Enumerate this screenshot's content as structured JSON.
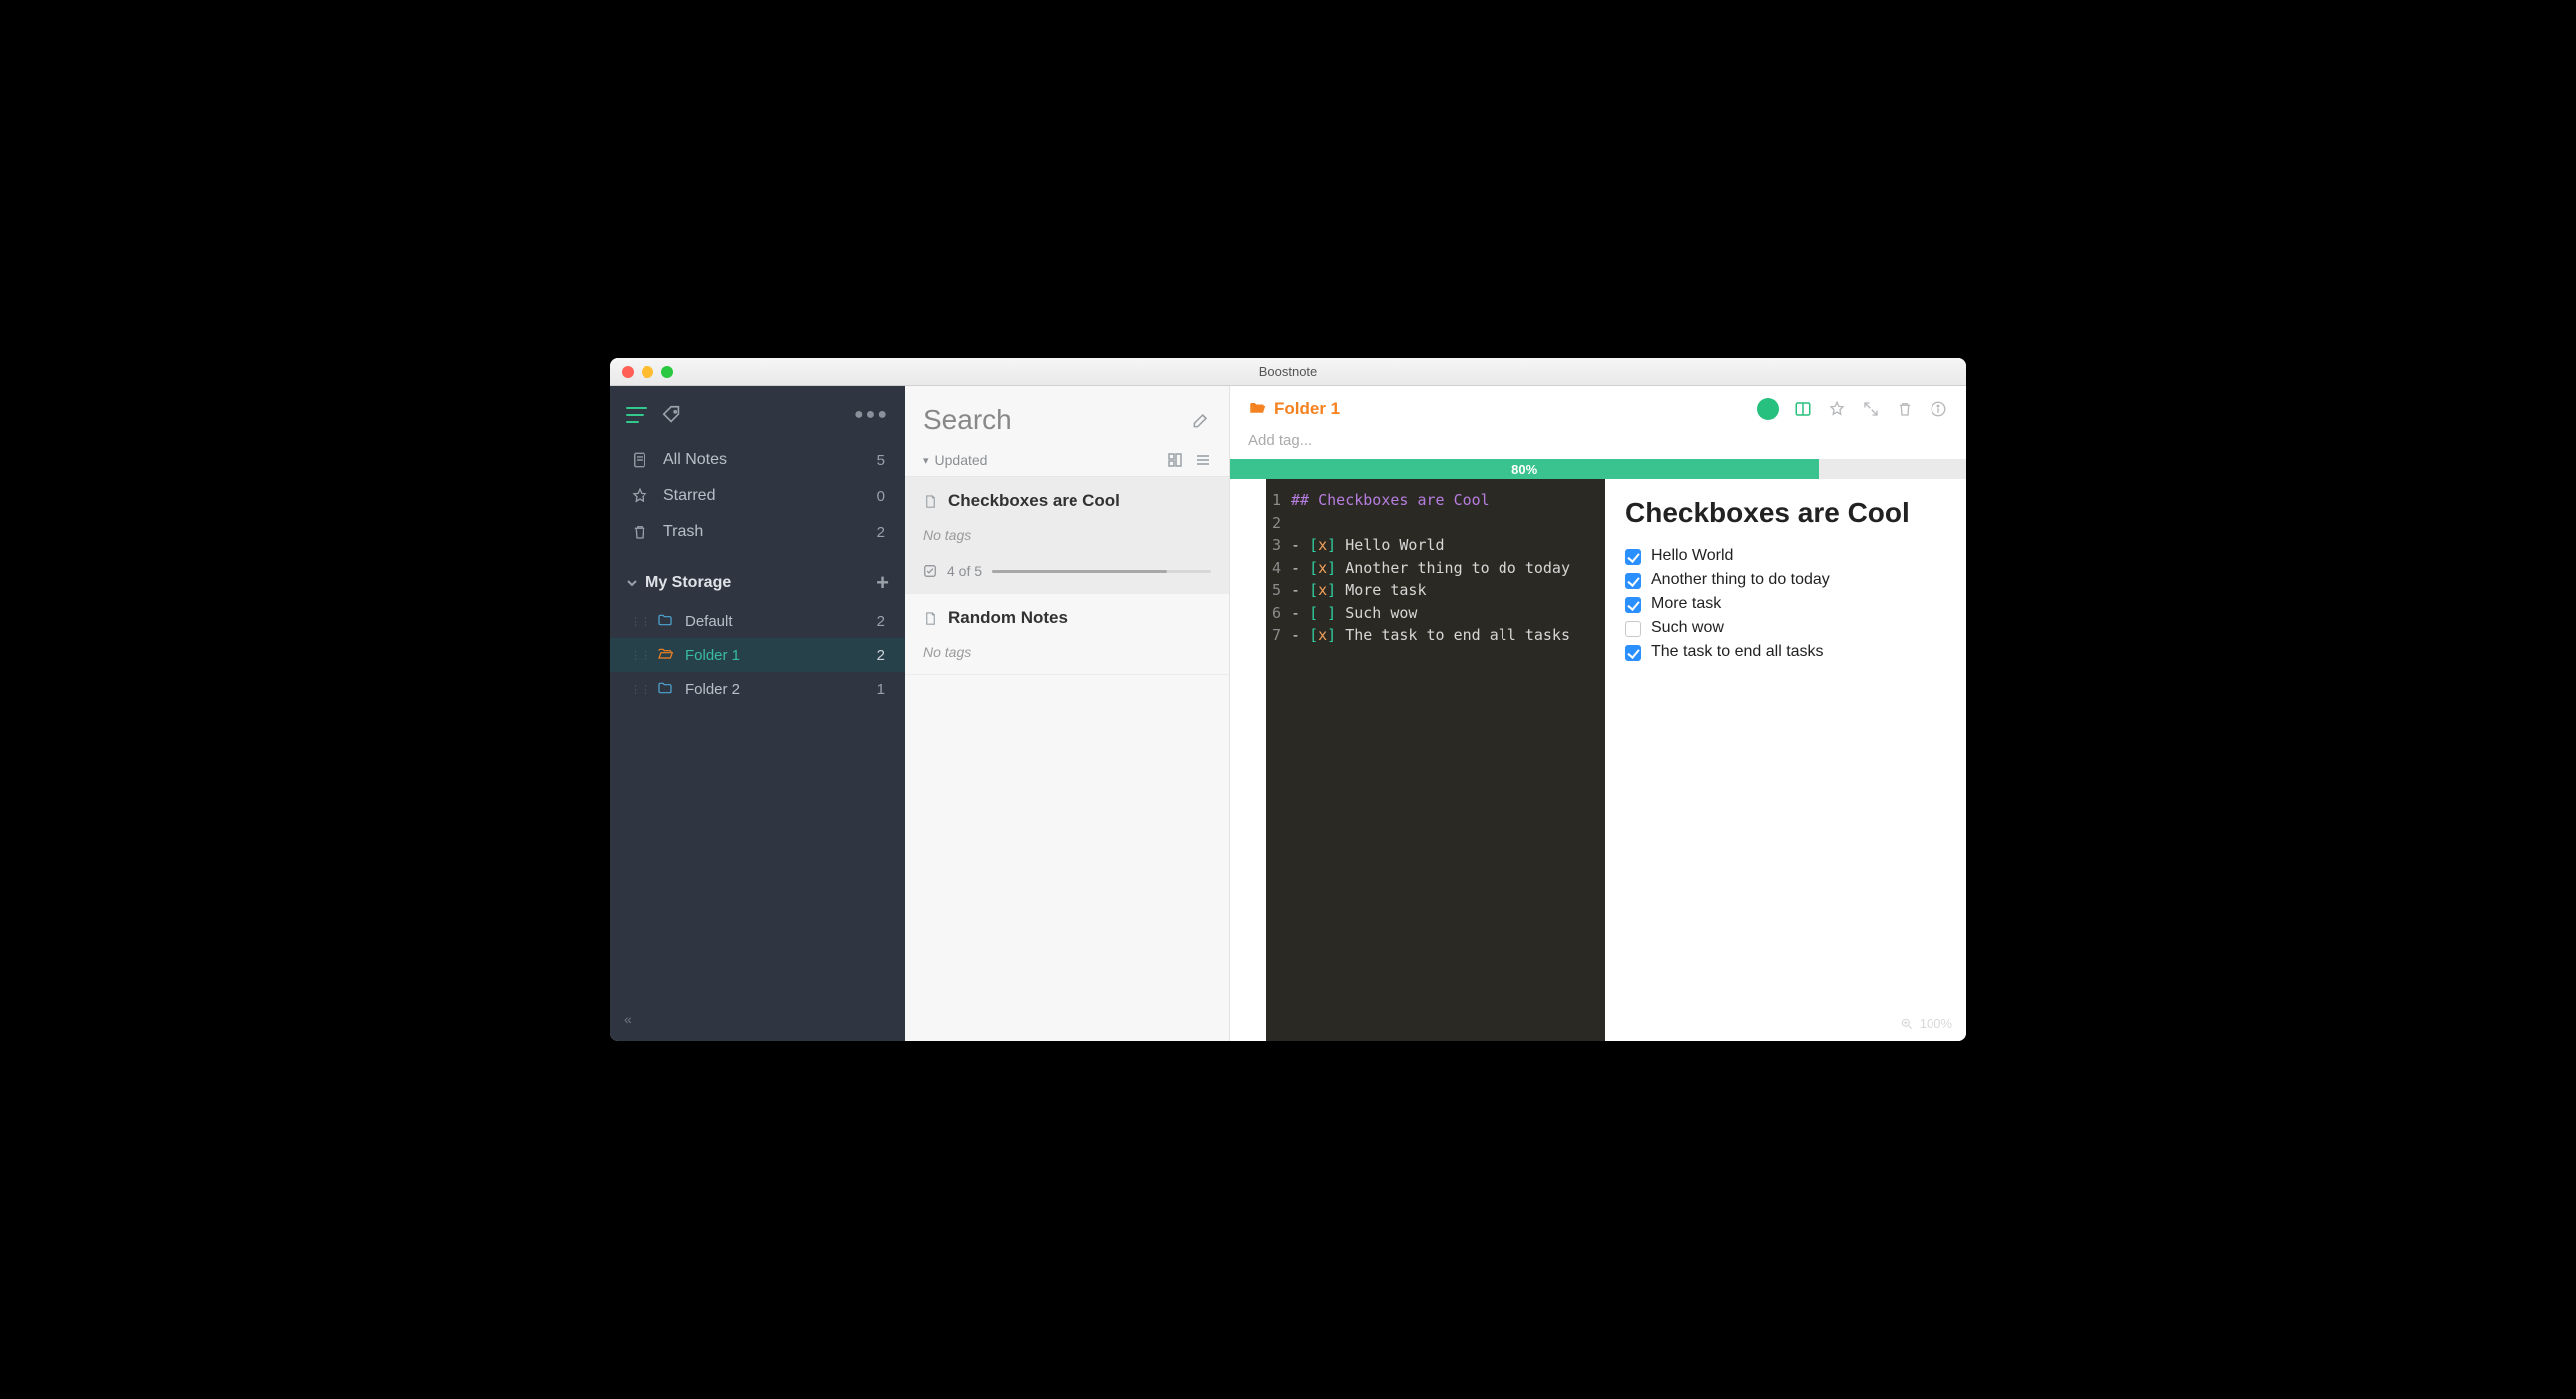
{
  "window": {
    "title": "Boostnote"
  },
  "sidebar": {
    "nav": [
      {
        "id": "all-notes",
        "label": "All Notes",
        "count": 5
      },
      {
        "id": "starred",
        "label": "Starred",
        "count": 0
      },
      {
        "id": "trash",
        "label": "Trash",
        "count": 2
      }
    ],
    "storage_label": "My Storage",
    "folders": [
      {
        "id": "default",
        "label": "Default",
        "count": 2,
        "active": false
      },
      {
        "id": "folder-1",
        "label": "Folder 1",
        "count": 2,
        "active": true
      },
      {
        "id": "folder-2",
        "label": "Folder 2",
        "count": 1,
        "active": false
      }
    ]
  },
  "notelist": {
    "search_placeholder": "Search",
    "sort_label": "Updated",
    "notes": [
      {
        "id": "checkboxes",
        "title": "Checkboxes are Cool",
        "tags_label": "No tags",
        "progress_label": "4 of 5",
        "progress_pct": 80,
        "selected": true,
        "has_progress": true
      },
      {
        "id": "random",
        "title": "Random Notes",
        "tags_label": "No tags",
        "selected": false,
        "has_progress": false
      }
    ]
  },
  "editor": {
    "folder_label": "Folder 1",
    "tag_placeholder": "Add tag...",
    "progress_pct": 80,
    "progress_label": "80%",
    "code_lines": [
      {
        "n": 1,
        "segs": [
          {
            "t": "## ",
            "c": "h"
          },
          {
            "t": "Checkboxes are Cool",
            "c": "h"
          }
        ]
      },
      {
        "n": 2,
        "segs": []
      },
      {
        "n": 3,
        "segs": [
          {
            "t": "- ",
            "c": ""
          },
          {
            "t": "[",
            "c": "k"
          },
          {
            "t": "x",
            "c": "x"
          },
          {
            "t": "]",
            "c": "k"
          },
          {
            "t": " Hello World",
            "c": ""
          }
        ]
      },
      {
        "n": 4,
        "segs": [
          {
            "t": "- ",
            "c": ""
          },
          {
            "t": "[",
            "c": "k"
          },
          {
            "t": "x",
            "c": "x"
          },
          {
            "t": "]",
            "c": "k"
          },
          {
            "t": " Another thing to do today",
            "c": ""
          }
        ]
      },
      {
        "n": 5,
        "segs": [
          {
            "t": "- ",
            "c": ""
          },
          {
            "t": "[",
            "c": "k"
          },
          {
            "t": "x",
            "c": "x"
          },
          {
            "t": "]",
            "c": "k"
          },
          {
            "t": " More task",
            "c": ""
          }
        ]
      },
      {
        "n": 6,
        "segs": [
          {
            "t": "- ",
            "c": ""
          },
          {
            "t": "[",
            "c": "k"
          },
          {
            "t": " ",
            "c": "x"
          },
          {
            "t": "]",
            "c": "k"
          },
          {
            "t": " Such wow",
            "c": ""
          }
        ]
      },
      {
        "n": 7,
        "segs": [
          {
            "t": "- ",
            "c": ""
          },
          {
            "t": "[",
            "c": "k"
          },
          {
            "t": "x",
            "c": "x"
          },
          {
            "t": "]",
            "c": "k"
          },
          {
            "t": " The task to end all tasks",
            "c": ""
          }
        ]
      }
    ],
    "preview": {
      "heading": "Checkboxes are Cool",
      "items": [
        {
          "text": "Hello World",
          "checked": true
        },
        {
          "text": "Another thing to do today",
          "checked": true
        },
        {
          "text": "More task",
          "checked": true
        },
        {
          "text": "Such wow",
          "checked": false
        },
        {
          "text": "The task to end all tasks",
          "checked": true
        }
      ]
    },
    "zoom_label": "100%"
  }
}
